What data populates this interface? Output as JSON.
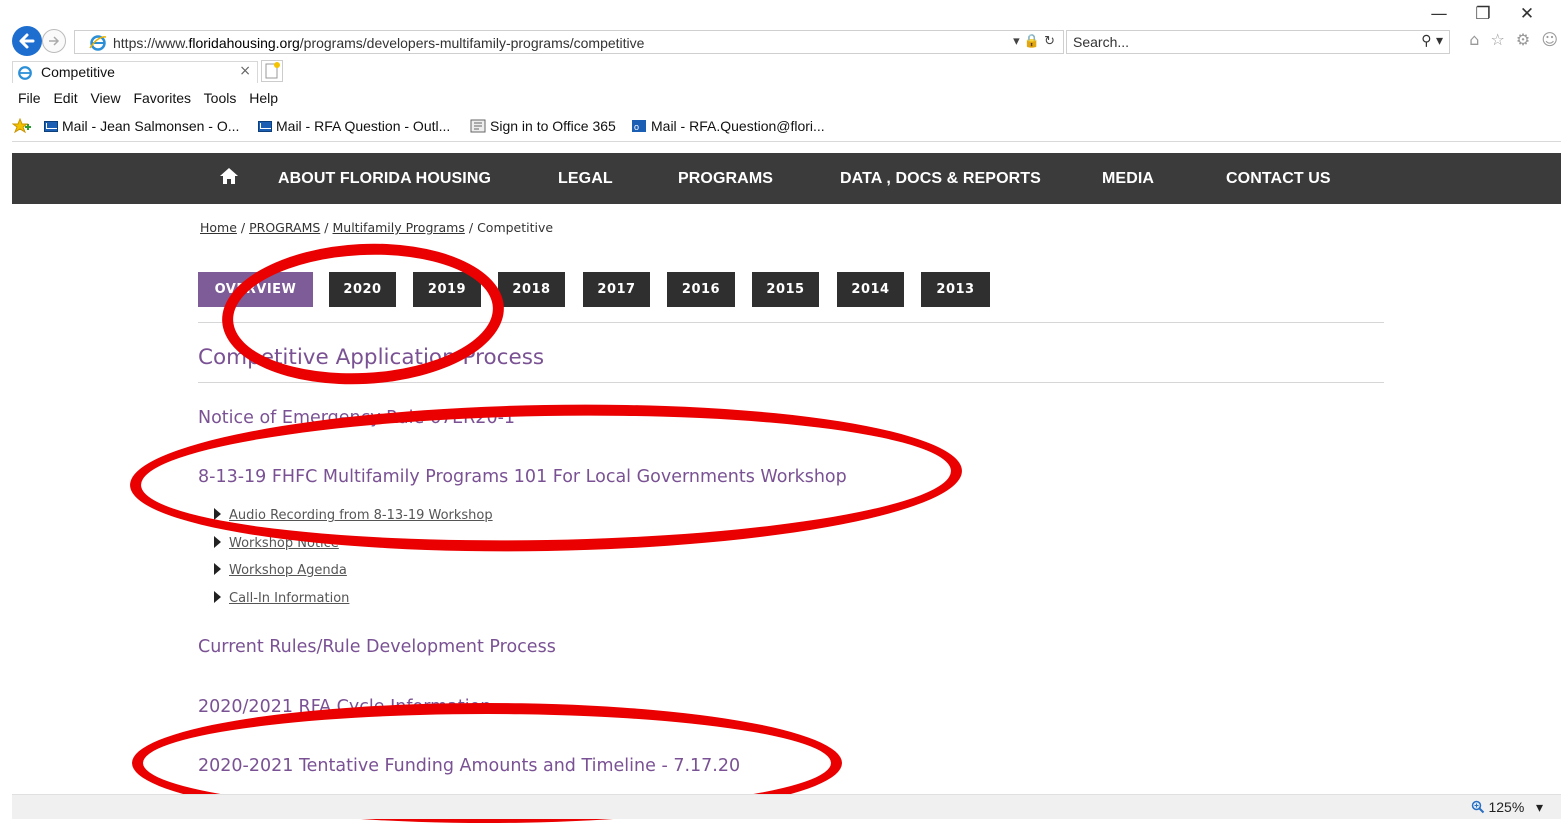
{
  "browser": {
    "url_prefix": "https://www.",
    "url_host": "floridahousing.org",
    "url_path": "/programs/developers-multifamily-programs/competitive",
    "url_icons": "▾ 🔒 ↻",
    "search_placeholder": "Search...",
    "search_icon": "⚲ ▾",
    "window_controls": [
      "—",
      "❐",
      "✕"
    ],
    "toolbar_icons": "⌂ ☆ ⚙ ☺",
    "tab_title": "Competitive",
    "tab_close": "×",
    "menu": [
      "File",
      "Edit",
      "View",
      "Favorites",
      "Tools",
      "Help"
    ],
    "favorites": [
      "Mail - Jean Salmonsen - O...",
      "Mail - RFA Question - Outl...",
      "Sign in to Office 365",
      "Mail - RFA.Question@flori..."
    ],
    "zoom": "125%",
    "zoom_arrow": "▾"
  },
  "site_nav": {
    "items": [
      "ABOUT FLORIDA HOUSING",
      "LEGAL",
      "PROGRAMS",
      "DATA , DOCS & REPORTS",
      "MEDIA",
      "CONTACT US"
    ]
  },
  "breadcrumb": {
    "home": "Home",
    "programs": "PROGRAMS",
    "multifamily": "Multifamily Programs",
    "current": "Competitive",
    "sep": "/"
  },
  "year_tabs": [
    "OVERVIEW",
    "2020",
    "2019",
    "2018",
    "2017",
    "2016",
    "2015",
    "2014",
    "2013"
  ],
  "content": {
    "title": "Competitive Application Process",
    "sections": [
      "Notice of Emergency Rule 67ER20-1",
      "8-13-19 FHFC Multifamily Programs 101 For Local Governments Workshop",
      "Current Rules/Rule Development Process",
      "2020/2021 RFA Cycle Information",
      "2020-2021 Tentative Funding Amounts and Timeline - 7.17.20"
    ],
    "workshop_links": [
      "Audio Recording from 8-13-19 Workshop",
      "Workshop Notice",
      "Workshop Agenda",
      "Call-In Information"
    ]
  },
  "colors": {
    "accent_purple": "#7a5294",
    "overview_tab": "#7d5c97",
    "nav_bg": "#3b3b3b",
    "annotation_red": "#ea0000"
  }
}
